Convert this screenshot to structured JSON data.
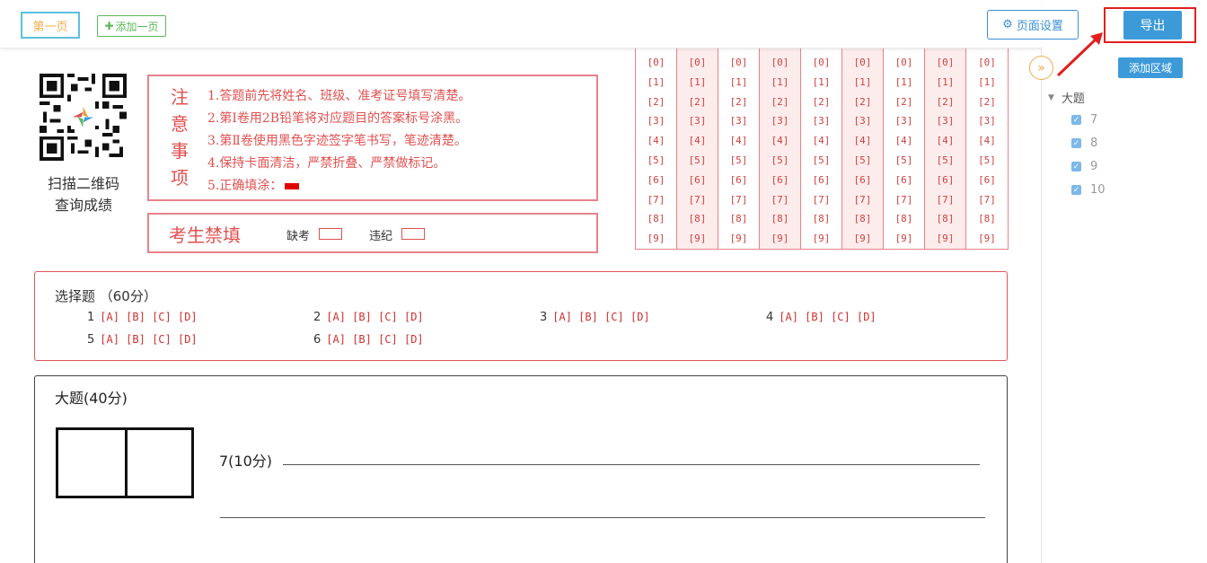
{
  "toolbar": {
    "page_tab": "第一页",
    "add_page": "添加一页",
    "page_settings": "页面设置",
    "export": "导出"
  },
  "sidebar": {
    "add_area": "添加区域",
    "tree_root": "大题",
    "items": [
      "7",
      "8",
      "9",
      "10"
    ]
  },
  "qr": {
    "line1": "扫描二维码",
    "line2": "查询成绩"
  },
  "notice": {
    "title_chars": [
      "注",
      "意",
      "事",
      "项"
    ],
    "lines": [
      "1.答题前先将姓名、班级、准考证号填写清楚。",
      "2.第Ⅰ卷用2B铅笔将对应题目的答案标号涂黑。",
      "3.第Ⅱ卷使用黑色字迹签字笔书写，笔迹清楚。",
      "4.保持卡面清洁，严禁折叠、严禁做标记。",
      "5.正确填涂："
    ]
  },
  "forbid": {
    "title": "考生禁填",
    "absent": "缺考",
    "violation": "违纪"
  },
  "id_grid": {
    "digits": [
      "[0]",
      "[1]",
      "[2]",
      "[3]",
      "[4]",
      "[5]",
      "[6]",
      "[7]",
      "[8]",
      "[9]"
    ],
    "columns": 9
  },
  "choice": {
    "title": "选择题 （60分）",
    "questions": [
      {
        "num": "1",
        "options": "[A]  [B]  [C]  [D]"
      },
      {
        "num": "2",
        "options": "[A]  [B]  [C]  [D]"
      },
      {
        "num": "3",
        "options": "[A]  [B]  [C]  [D]"
      },
      {
        "num": "4",
        "options": "[A]  [B]  [C]  [D]"
      },
      {
        "num": "5",
        "options": "[A]  [B]  [C]  [D]"
      },
      {
        "num": "6",
        "options": "[A]  [B]  [C]  [D]"
      }
    ]
  },
  "big": {
    "title": "大题(40分)",
    "q7": "7(10分)"
  },
  "colors": {
    "accent_blue": "#3d9ad8",
    "sheet_red": "#e05050",
    "highlight_red": "#e02020"
  }
}
